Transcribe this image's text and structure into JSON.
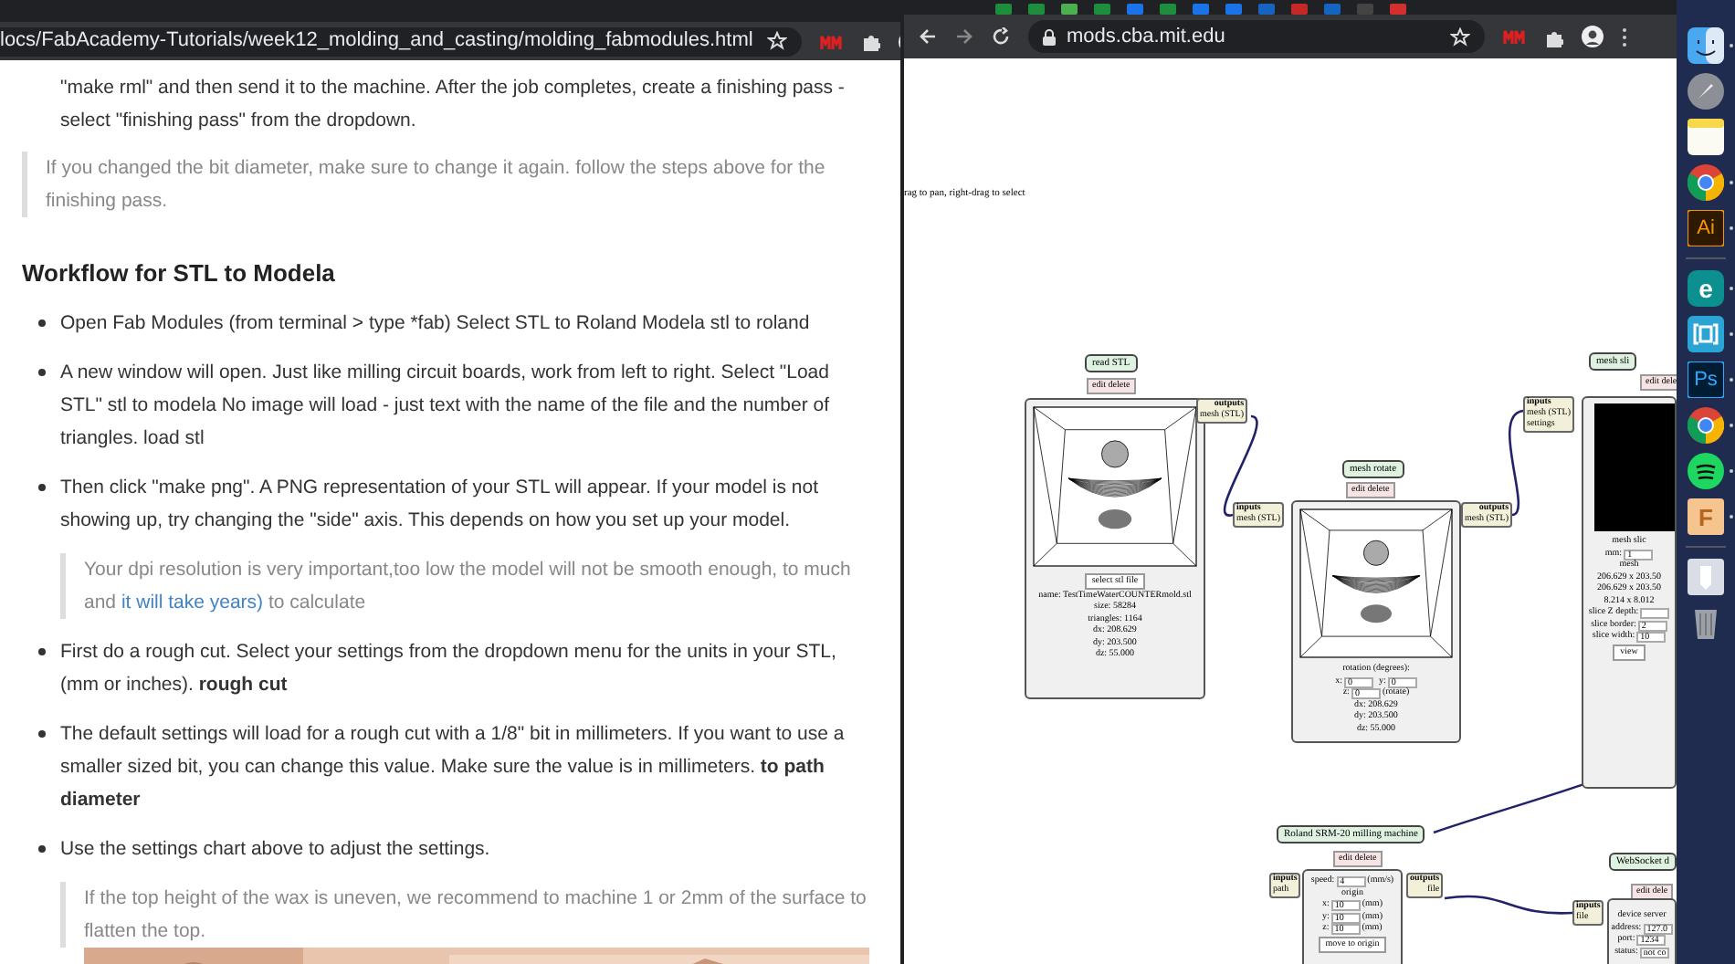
{
  "left_browser": {
    "url": "locs/FabAcademy-Tutorials/week12_molding_and_casting/molding_fabmodules.html",
    "page": {
      "intro": "\"make rml\" and then send it to the machine. After the job completes, create a finishing pass - select \"finishing pass\" from the dropdown.",
      "note": "If you changed the bit diameter, make sure to change it again. follow the steps above for the finishing pass.",
      "heading": "Workflow for STL to Modela",
      "bullets": [
        {
          "parts": [
            {
              "text": "Open Fab Modules (from terminal > type *fab) Select STL to Roland Modela stl to roland",
              "bold": false
            }
          ]
        },
        {
          "parts": [
            {
              "text": "A new window will open. Just like milling circuit boards, work from left to right. Select \"Load STL\" stl to modela No image will load - just text with the name of the file and the number of triangles. load stl",
              "bold": false
            }
          ]
        },
        {
          "parts": [
            {
              "text": "Then click \"make png\". A PNG representation of your STL will appear. If your model is not showing up, try changing the \"side\" axis. This depends on how you set up your model.",
              "bold": false
            }
          ],
          "quote": [
            {
              "text": "Your dpi resolution is very important,too low the model will not be smooth enough, to much and ",
              "link": false
            },
            {
              "text": "it will take years)",
              "link": true
            },
            {
              "text": " to calculate",
              "link": false
            }
          ]
        },
        {
          "parts": [
            {
              "text": "First do a rough cut. Select your settings from the dropdown menu for the units in your STL, (mm or inches). ",
              "bold": false
            },
            {
              "text": "rough cut",
              "bold": true
            }
          ]
        },
        {
          "parts": [
            {
              "text": "The default settings will load for a rough cut with a 1/8\" bit in millimeters. If you want to use a smaller sized bit, you can change this value. Make sure the value is in millimeters. ",
              "bold": false
            },
            {
              "text": "to path diameter",
              "bold": true
            }
          ]
        },
        {
          "parts": [
            {
              "text": "Use the settings chart above to adjust the settings.",
              "bold": false
            }
          ],
          "quote": [
            {
              "text": "If the top height of the wax is uneven, we recommend to machine 1 or 2mm of the surface to flatten the top.",
              "link": false
            }
          ],
          "picture": {
            "kind": "picture"
          }
        }
      ]
    }
  },
  "right_browser": {
    "url": "mods.cba.mit.edu",
    "canvas": {
      "hint": "rag to pan, right-drag to select",
      "nodes": [
        {
          "title": "read STL",
          "actions": "edit delete",
          "outputs": [
            "outputs",
            "mesh (STL)"
          ],
          "kind": "mesh_view",
          "fields": [
            {
              "kind": "button",
              "text": "select stl file"
            },
            {
              "kind": "text",
              "text": "name: TestTimeWaterCOUNTERmold.stl"
            },
            {
              "kind": "text",
              "text": "size: 58284"
            },
            {
              "kind": "text",
              "text": "triangles: 1164"
            },
            {
              "kind": "text",
              "text": "dx: 208.629"
            },
            {
              "kind": "text",
              "text": "dy: 203.500"
            },
            {
              "kind": "text",
              "text": "dz: 55.000"
            }
          ]
        },
        {
          "title": "mesh rotate",
          "actions": "edit delete",
          "inputs": [
            "inputs",
            "mesh (STL)"
          ],
          "outputs": [
            "outputs",
            "mesh (STL)"
          ],
          "kind": "mesh_view",
          "fields": [
            {
              "kind": "text",
              "text": "rotation (degrees):"
            },
            {
              "kind": "pair",
              "label": "x:",
              "value": "0",
              "label2": "y:",
              "value2": "0"
            },
            {
              "kind": "input",
              "label": "z:",
              "value": "0",
              "unit": "(rotate)"
            },
            {
              "kind": "text",
              "text": "dx: 208.629"
            },
            {
              "kind": "text",
              "text": "dy: 203.500"
            },
            {
              "kind": "text",
              "text": "dz: 55.000"
            }
          ]
        },
        {
          "title": "mesh sli",
          "actions": "edit dele",
          "inputs": [
            "inputs",
            "mesh (STL)",
            "settings"
          ],
          "kind": "slicer",
          "fields": [
            {
              "kind": "text",
              "text": "mesh slic"
            },
            {
              "kind": "input",
              "label": "mm:",
              "value": "1"
            },
            {
              "kind": "text",
              "text": "mesh"
            },
            {
              "kind": "text",
              "text": "206.629 x 203.50"
            },
            {
              "kind": "text",
              "text": "206.629 x 203.50"
            },
            {
              "kind": "text",
              "text": "8.214 x 8.012"
            },
            {
              "kind": "input",
              "label": "slice Z depth:"
            },
            {
              "kind": "input",
              "label": "slice border:",
              "value": "2"
            },
            {
              "kind": "input",
              "label": "slice width:",
              "value": "10"
            },
            {
              "kind": "button",
              "text": "view"
            }
          ]
        },
        {
          "title": "Roland SRM-20 milling machine",
          "actions": "edit delete",
          "inputs": [
            "inputs",
            "path"
          ],
          "outputs": [
            "outputs",
            "file"
          ],
          "kind": "machine",
          "fields": [
            {
              "kind": "input",
              "label": "speed:",
              "value": "4",
              "unit": "(mm/s)"
            },
            {
              "kind": "text",
              "text": "origin"
            },
            {
              "kind": "input",
              "label": "x:",
              "value": "10",
              "unit": "(mm)"
            },
            {
              "kind": "input",
              "label": "y:",
              "value": "10",
              "unit": "(mm)"
            },
            {
              "kind": "input",
              "label": "z:",
              "value": "10",
              "unit": "(mm)"
            },
            {
              "kind": "button",
              "text": "move to origin"
            }
          ]
        },
        {
          "title": "WebSocket d",
          "actions": "edit dele",
          "inputs": [
            "inputs",
            "file"
          ],
          "kind": "server",
          "fields": [
            {
              "kind": "text",
              "text": "device server"
            },
            {
              "kind": "input",
              "label": "address:",
              "value": "127.0"
            },
            {
              "kind": "input",
              "label": "port:",
              "value": "1234"
            },
            {
              "kind": "input",
              "label": "status:",
              "value": "not co"
            }
          ]
        }
      ]
    }
  },
  "dock": [
    {
      "kind": "finder",
      "running": true
    },
    {
      "kind": "rocket",
      "running": false
    },
    {
      "kind": "notes",
      "running": false
    },
    {
      "kind": "chrome",
      "running": true
    },
    {
      "kind": "ai",
      "label": "Ai",
      "running": true
    },
    {
      "kind": "separator"
    },
    {
      "kind": "e",
      "label": "e",
      "running": true
    },
    {
      "kind": "bracket",
      "running": true
    },
    {
      "kind": "ps",
      "label": "Ps",
      "running": true
    },
    {
      "kind": "chrome",
      "running": true
    },
    {
      "kind": "spotify",
      "running": true
    },
    {
      "kind": "f",
      "label": "F",
      "running": true
    },
    {
      "kind": "separator"
    },
    {
      "kind": "downloads",
      "running": false
    },
    {
      "kind": "trash",
      "running": false
    }
  ]
}
